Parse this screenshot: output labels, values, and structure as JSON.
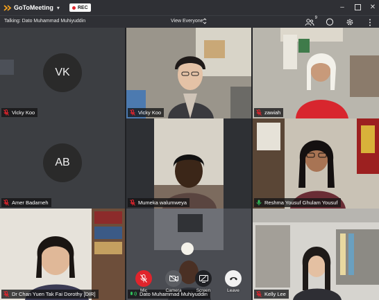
{
  "app": {
    "title": "GoToMeeting",
    "rec_label": "REC"
  },
  "subbar": {
    "talking": "Talking: Dato Muhammad Muhiyuddin",
    "view": "View Everyone",
    "participant_count": "9"
  },
  "tiles": [
    {
      "name": "Vicky Koo",
      "initials": "VK",
      "muted": true
    },
    {
      "name": "Vicky Koo",
      "muted": true
    },
    {
      "name": "zawiah",
      "muted": true
    },
    {
      "name": "Amer Badarneh",
      "initials": "AB",
      "muted": true
    },
    {
      "name": "Mumeka walumweya",
      "muted": true
    },
    {
      "name": "Reshma Yousuf Ghulam Yousuf",
      "muted": false
    },
    {
      "name": "Dr Chan Yuen Tak Fai Dorothy [DIR]",
      "muted": true
    },
    {
      "name": "Dato Muhammad Muhiyuddin",
      "muted": false
    },
    {
      "name": "Kelly Lee",
      "muted": true
    }
  ],
  "controls": {
    "mic": "Mic",
    "camera": "Camera",
    "screen": "Screen",
    "leave": "Leave"
  },
  "colors": {
    "rec_red": "#e0242c",
    "muted_red": "#e0242c",
    "unmuted_green": "#2fbf5a",
    "active_outline": "#2b6fe0"
  }
}
